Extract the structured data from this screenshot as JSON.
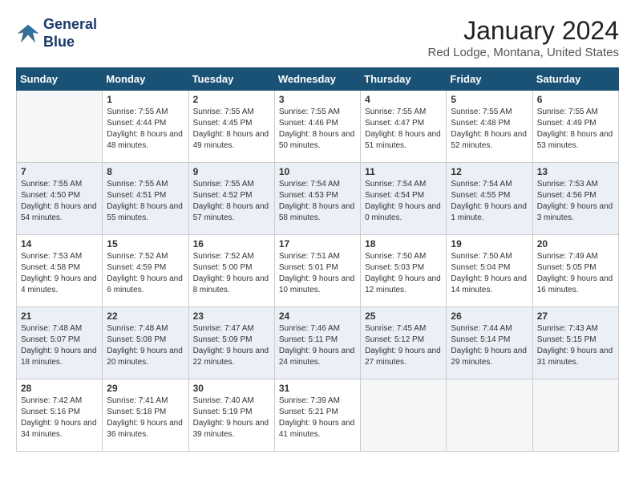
{
  "header": {
    "logo_line1": "General",
    "logo_line2": "Blue",
    "title": "January 2024",
    "subtitle": "Red Lodge, Montana, United States"
  },
  "weekdays": [
    "Sunday",
    "Monday",
    "Tuesday",
    "Wednesday",
    "Thursday",
    "Friday",
    "Saturday"
  ],
  "weeks": [
    [
      {
        "day": "",
        "sunrise": "",
        "sunset": "",
        "daylight": ""
      },
      {
        "day": "1",
        "sunrise": "Sunrise: 7:55 AM",
        "sunset": "Sunset: 4:44 PM",
        "daylight": "Daylight: 8 hours and 48 minutes."
      },
      {
        "day": "2",
        "sunrise": "Sunrise: 7:55 AM",
        "sunset": "Sunset: 4:45 PM",
        "daylight": "Daylight: 8 hours and 49 minutes."
      },
      {
        "day": "3",
        "sunrise": "Sunrise: 7:55 AM",
        "sunset": "Sunset: 4:46 PM",
        "daylight": "Daylight: 8 hours and 50 minutes."
      },
      {
        "day": "4",
        "sunrise": "Sunrise: 7:55 AM",
        "sunset": "Sunset: 4:47 PM",
        "daylight": "Daylight: 8 hours and 51 minutes."
      },
      {
        "day": "5",
        "sunrise": "Sunrise: 7:55 AM",
        "sunset": "Sunset: 4:48 PM",
        "daylight": "Daylight: 8 hours and 52 minutes."
      },
      {
        "day": "6",
        "sunrise": "Sunrise: 7:55 AM",
        "sunset": "Sunset: 4:49 PM",
        "daylight": "Daylight: 8 hours and 53 minutes."
      }
    ],
    [
      {
        "day": "7",
        "sunrise": "Sunrise: 7:55 AM",
        "sunset": "Sunset: 4:50 PM",
        "daylight": "Daylight: 8 hours and 54 minutes."
      },
      {
        "day": "8",
        "sunrise": "Sunrise: 7:55 AM",
        "sunset": "Sunset: 4:51 PM",
        "daylight": "Daylight: 8 hours and 55 minutes."
      },
      {
        "day": "9",
        "sunrise": "Sunrise: 7:55 AM",
        "sunset": "Sunset: 4:52 PM",
        "daylight": "Daylight: 8 hours and 57 minutes."
      },
      {
        "day": "10",
        "sunrise": "Sunrise: 7:54 AM",
        "sunset": "Sunset: 4:53 PM",
        "daylight": "Daylight: 8 hours and 58 minutes."
      },
      {
        "day": "11",
        "sunrise": "Sunrise: 7:54 AM",
        "sunset": "Sunset: 4:54 PM",
        "daylight": "Daylight: 9 hours and 0 minutes."
      },
      {
        "day": "12",
        "sunrise": "Sunrise: 7:54 AM",
        "sunset": "Sunset: 4:55 PM",
        "daylight": "Daylight: 9 hours and 1 minute."
      },
      {
        "day": "13",
        "sunrise": "Sunrise: 7:53 AM",
        "sunset": "Sunset: 4:56 PM",
        "daylight": "Daylight: 9 hours and 3 minutes."
      }
    ],
    [
      {
        "day": "14",
        "sunrise": "Sunrise: 7:53 AM",
        "sunset": "Sunset: 4:58 PM",
        "daylight": "Daylight: 9 hours and 4 minutes."
      },
      {
        "day": "15",
        "sunrise": "Sunrise: 7:52 AM",
        "sunset": "Sunset: 4:59 PM",
        "daylight": "Daylight: 9 hours and 6 minutes."
      },
      {
        "day": "16",
        "sunrise": "Sunrise: 7:52 AM",
        "sunset": "Sunset: 5:00 PM",
        "daylight": "Daylight: 9 hours and 8 minutes."
      },
      {
        "day": "17",
        "sunrise": "Sunrise: 7:51 AM",
        "sunset": "Sunset: 5:01 PM",
        "daylight": "Daylight: 9 hours and 10 minutes."
      },
      {
        "day": "18",
        "sunrise": "Sunrise: 7:50 AM",
        "sunset": "Sunset: 5:03 PM",
        "daylight": "Daylight: 9 hours and 12 minutes."
      },
      {
        "day": "19",
        "sunrise": "Sunrise: 7:50 AM",
        "sunset": "Sunset: 5:04 PM",
        "daylight": "Daylight: 9 hours and 14 minutes."
      },
      {
        "day": "20",
        "sunrise": "Sunrise: 7:49 AM",
        "sunset": "Sunset: 5:05 PM",
        "daylight": "Daylight: 9 hours and 16 minutes."
      }
    ],
    [
      {
        "day": "21",
        "sunrise": "Sunrise: 7:48 AM",
        "sunset": "Sunset: 5:07 PM",
        "daylight": "Daylight: 9 hours and 18 minutes."
      },
      {
        "day": "22",
        "sunrise": "Sunrise: 7:48 AM",
        "sunset": "Sunset: 5:08 PM",
        "daylight": "Daylight: 9 hours and 20 minutes."
      },
      {
        "day": "23",
        "sunrise": "Sunrise: 7:47 AM",
        "sunset": "Sunset: 5:09 PM",
        "daylight": "Daylight: 9 hours and 22 minutes."
      },
      {
        "day": "24",
        "sunrise": "Sunrise: 7:46 AM",
        "sunset": "Sunset: 5:11 PM",
        "daylight": "Daylight: 9 hours and 24 minutes."
      },
      {
        "day": "25",
        "sunrise": "Sunrise: 7:45 AM",
        "sunset": "Sunset: 5:12 PM",
        "daylight": "Daylight: 9 hours and 27 minutes."
      },
      {
        "day": "26",
        "sunrise": "Sunrise: 7:44 AM",
        "sunset": "Sunset: 5:14 PM",
        "daylight": "Daylight: 9 hours and 29 minutes."
      },
      {
        "day": "27",
        "sunrise": "Sunrise: 7:43 AM",
        "sunset": "Sunset: 5:15 PM",
        "daylight": "Daylight: 9 hours and 31 minutes."
      }
    ],
    [
      {
        "day": "28",
        "sunrise": "Sunrise: 7:42 AM",
        "sunset": "Sunset: 5:16 PM",
        "daylight": "Daylight: 9 hours and 34 minutes."
      },
      {
        "day": "29",
        "sunrise": "Sunrise: 7:41 AM",
        "sunset": "Sunset: 5:18 PM",
        "daylight": "Daylight: 9 hours and 36 minutes."
      },
      {
        "day": "30",
        "sunrise": "Sunrise: 7:40 AM",
        "sunset": "Sunset: 5:19 PM",
        "daylight": "Daylight: 9 hours and 39 minutes."
      },
      {
        "day": "31",
        "sunrise": "Sunrise: 7:39 AM",
        "sunset": "Sunset: 5:21 PM",
        "daylight": "Daylight: 9 hours and 41 minutes."
      },
      {
        "day": "",
        "sunrise": "",
        "sunset": "",
        "daylight": ""
      },
      {
        "day": "",
        "sunrise": "",
        "sunset": "",
        "daylight": ""
      },
      {
        "day": "",
        "sunrise": "",
        "sunset": "",
        "daylight": ""
      }
    ]
  ]
}
